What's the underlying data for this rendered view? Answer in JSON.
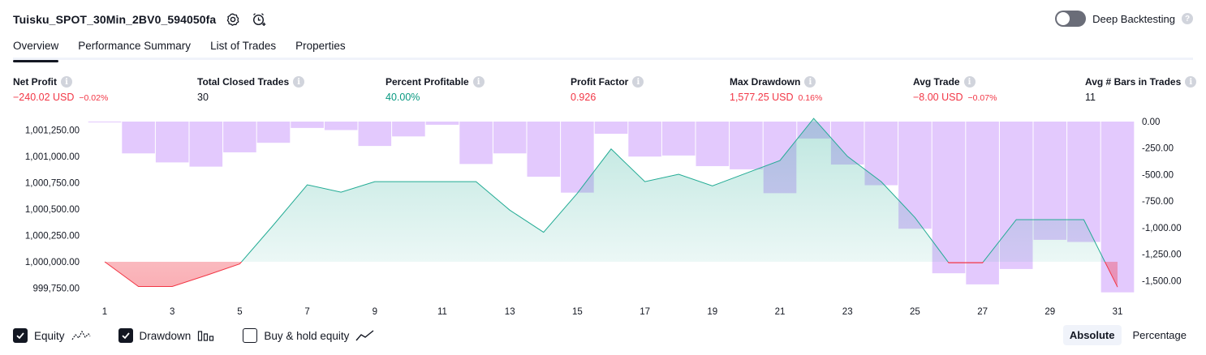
{
  "header": {
    "strategy_name": "Tuisku_SPOT_30Min_2BV0_594050fa",
    "settings_icon": "gear-icon",
    "alert_icon": "add-alert-icon"
  },
  "deep_backtesting": {
    "label": "Deep Backtesting",
    "enabled": false,
    "help_icon": "question-icon"
  },
  "tabs": [
    {
      "label": "Overview",
      "active": true
    },
    {
      "label": "Performance Summary",
      "active": false
    },
    {
      "label": "List of Trades",
      "active": false
    },
    {
      "label": "Properties",
      "active": false
    }
  ],
  "metrics": [
    {
      "label": "Net Profit",
      "value": "−240.02 USD",
      "pct": "−0.02%",
      "tone": "neg"
    },
    {
      "label": "Total Closed Trades",
      "value": "30",
      "pct": "",
      "tone": "neutral"
    },
    {
      "label": "Percent Profitable",
      "value": "40.00%",
      "pct": "",
      "tone": "pos"
    },
    {
      "label": "Profit Factor",
      "value": "0.926",
      "pct": "",
      "tone": "neg"
    },
    {
      "label": "Max Drawdown",
      "value": "1,577.25 USD",
      "pct": "0.16%",
      "tone": "neg"
    },
    {
      "label": "Avg Trade",
      "value": "−8.00 USD",
      "pct": "−0.07%",
      "tone": "neg"
    },
    {
      "label": "Avg # Bars in Trades",
      "value": "11",
      "pct": "",
      "tone": "neutral"
    }
  ],
  "chart_data": {
    "type": "line+bar",
    "x_tick_labels": [
      "1",
      "3",
      "5",
      "7",
      "9",
      "11",
      "13",
      "15",
      "17",
      "19",
      "21",
      "23",
      "25",
      "27",
      "29",
      "31"
    ],
    "left_axis": {
      "tick_labels": [
        "1,001,250.00",
        "1,001,000.00",
        "1,000,750.00",
        "1,000,500.00",
        "1,000,250.00",
        "1,000,000.00",
        "999,750.00"
      ],
      "ylim": [
        999700,
        1001330
      ]
    },
    "right_axis": {
      "tick_labels": [
        "0.00",
        "-250.00",
        "-500.00",
        "-750.00",
        "-1,000.00",
        "-1,250.00",
        "-1,500.00"
      ],
      "ylim": [
        -1620,
        0
      ]
    },
    "baseline": 1000000,
    "series": [
      {
        "name": "Equity",
        "x": [
          1,
          2,
          3,
          4,
          5,
          6,
          7,
          8,
          9,
          10,
          11,
          12,
          13,
          14,
          15,
          16,
          17,
          18,
          19,
          20,
          21,
          22,
          23,
          24,
          25,
          26,
          27,
          28,
          29,
          30,
          31
        ],
        "values": [
          1000000,
          999765,
          999765,
          999870,
          999980,
          1000350,
          1000730,
          1000660,
          1000760,
          1000760,
          1000760,
          1000760,
          1000490,
          1000280,
          1000650,
          1001070,
          1000760,
          1000830,
          1000720,
          1000840,
          1000960,
          1001360,
          1001000,
          1000760,
          1000420,
          999990,
          999990,
          1000400,
          1000400,
          1000400,
          999760
        ]
      },
      {
        "name": "Drawdown",
        "x": [
          1,
          2,
          3,
          4,
          5,
          6,
          7,
          8,
          9,
          10,
          11,
          12,
          13,
          14,
          15,
          16,
          17,
          18,
          19,
          20,
          21,
          22,
          23,
          24,
          25,
          26,
          27,
          28,
          29,
          30,
          31
        ],
        "values": [
          0,
          -300,
          -385,
          -425,
          -290,
          -200,
          -60,
          -80,
          -230,
          -140,
          -30,
          -400,
          -300,
          -520,
          -670,
          -115,
          -330,
          -320,
          -420,
          -450,
          -675,
          -160,
          -405,
          -600,
          -1010,
          -1430,
          -1535,
          -1390,
          -1115,
          -1135,
          -1610
        ]
      }
    ]
  },
  "legend": [
    {
      "label": "Equity",
      "checked": true,
      "icon": "equity-line-icon"
    },
    {
      "label": "Drawdown",
      "checked": true,
      "icon": "drawdown-bars-icon"
    },
    {
      "label": "Buy & hold equity",
      "checked": false,
      "icon": "buy-hold-line-icon"
    }
  ],
  "view_mode": {
    "options": [
      "Absolute",
      "Percentage"
    ],
    "selected": "Absolute"
  },
  "colors": {
    "positive": "#089981",
    "negative": "#f23645",
    "drawdown_bar": "#e2c6fd",
    "equity_line": "#22ab94",
    "equity_loss": "#f23645"
  }
}
